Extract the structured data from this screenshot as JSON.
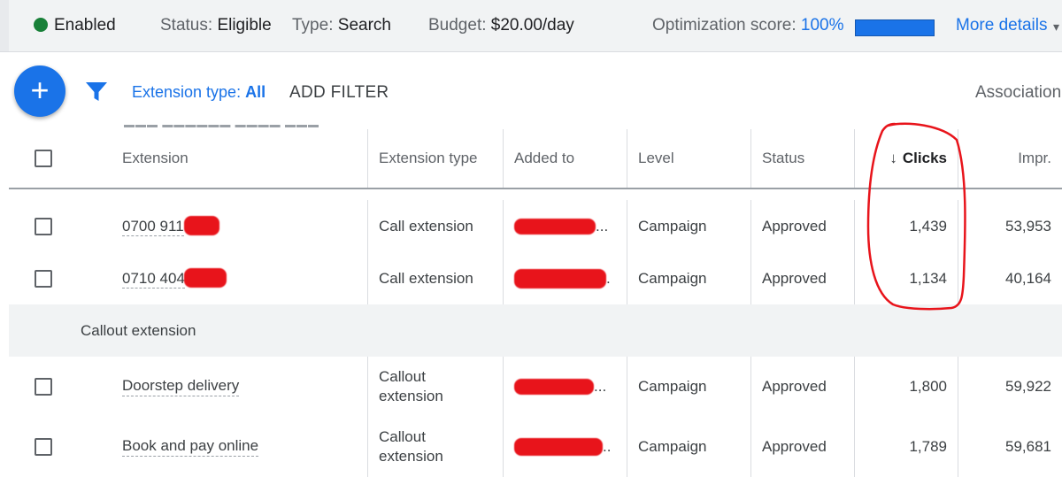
{
  "status_bar": {
    "enabled_label": "Enabled",
    "status_label": "Status:",
    "status_value": "Eligible",
    "type_label": "Type:",
    "type_value": "Search",
    "budget_label": "Budget:",
    "budget_value": "$20.00/day",
    "score_label": "Optimization score:",
    "score_value": "100%",
    "score_fraction": 1.0,
    "more_details": "More details"
  },
  "filter_bar": {
    "add_icon": "plus-icon",
    "filter_icon": "funnel-icon",
    "ext_type_label": "Extension type:",
    "ext_type_value": "All",
    "add_filter": "ADD FILTER",
    "association": "Association"
  },
  "table": {
    "headers": {
      "extension": "Extension",
      "extension_type": "Extension type",
      "added_to": "Added to",
      "level": "Level",
      "status": "Status",
      "clicks": "Clicks",
      "impr": "Impr."
    },
    "rows": [
      {
        "extension": "0700 911",
        "type": "Call extension",
        "added_to": "",
        "level": "Campaign",
        "status": "Approved",
        "clicks": "1,439",
        "impr": "53,953"
      },
      {
        "extension": "0710 404",
        "type": "Call extension",
        "added_to": "",
        "level": "Campaign",
        "status": "Approved",
        "clicks": "1,134",
        "impr": "40,164"
      }
    ],
    "group_label": "Callout extension",
    "callout_rows": [
      {
        "extension": "Doorstep delivery",
        "type_line1": "Callout",
        "type_line2": "extension",
        "added_to": "",
        "level": "Campaign",
        "status": "Approved",
        "clicks": "1,800",
        "impr": "59,922"
      },
      {
        "extension": "Book and pay online",
        "type_line1": "Callout",
        "type_line2": "extension",
        "added_to": "",
        "level": "Campaign",
        "status": "Approved",
        "clicks": "1,789",
        "impr": "59,681"
      }
    ]
  },
  "colors": {
    "accent": "#1a73e8",
    "enabled_dot": "#188038",
    "annotation": "#e8141b"
  }
}
